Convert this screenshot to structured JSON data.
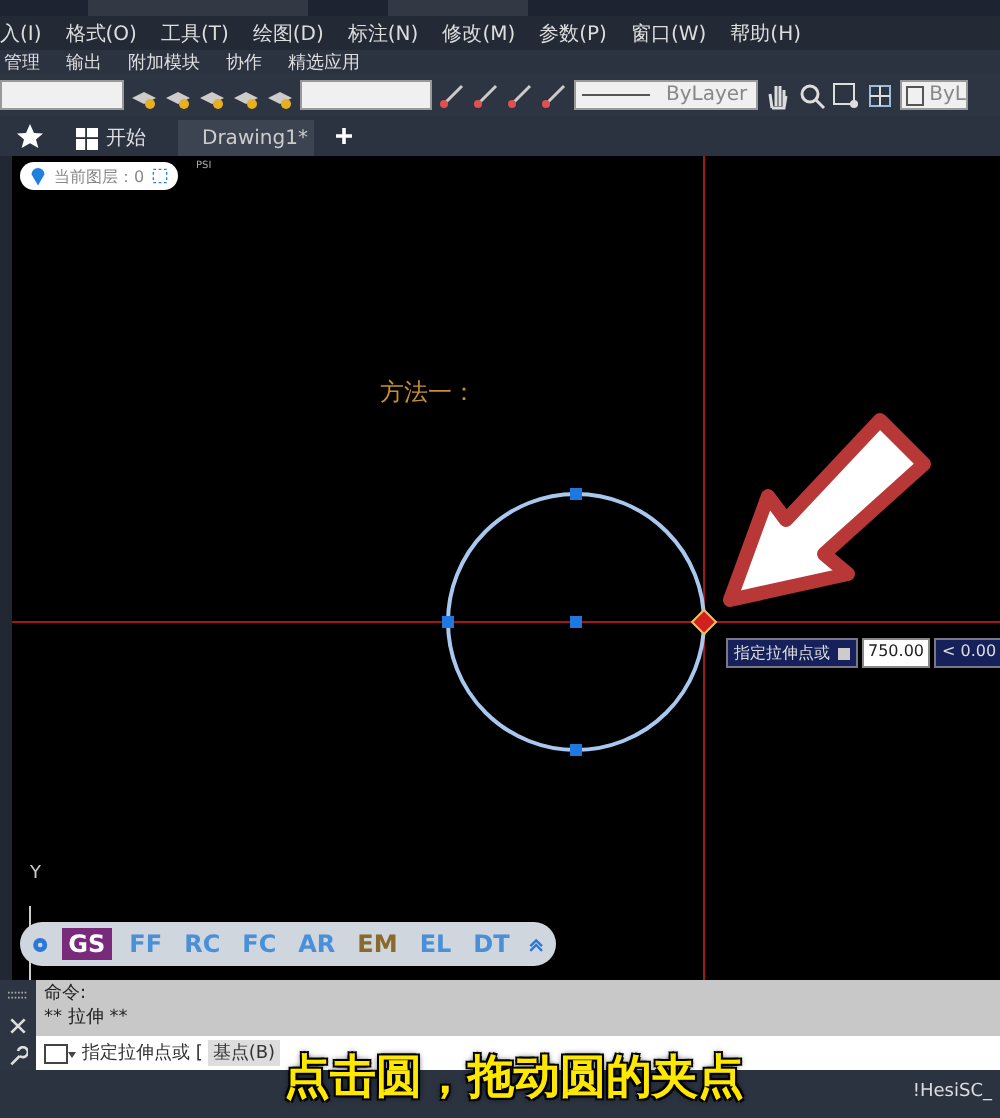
{
  "menu_bar": [
    "入(I)",
    "格式(O)",
    "工具(T)",
    "绘图(D)",
    "标注(N)",
    "修改(M)",
    "参数(P)",
    "窗口(W)",
    "帮助(H)"
  ],
  "ribbon_tabs": [
    "管理",
    "输出",
    "附加模块",
    "协作",
    "精选应用"
  ],
  "toolbar": {
    "linetype": "ByLayer",
    "lineweight": "ByL"
  },
  "file_tabs": [
    {
      "label": "开始",
      "selected": false
    },
    {
      "label": "Drawing1*",
      "selected": true
    }
  ],
  "canvas": {
    "layer_chip": "当前图层：0",
    "viewport_label": "PSI",
    "annotation": "方法一：",
    "axis_label": "Y",
    "dynamic_input": {
      "prompt": "指定拉伸点或",
      "value": "750.00",
      "angle": "< 0.00"
    },
    "quick_bar": [
      {
        "label": "GS",
        "selected": true,
        "color": "#7a2a7a"
      },
      {
        "label": "FF",
        "selected": false,
        "color": "#4a90d9"
      },
      {
        "label": "RC",
        "selected": false,
        "color": "#4a90d9"
      },
      {
        "label": "FC",
        "selected": false,
        "color": "#4a90d9"
      },
      {
        "label": "AR",
        "selected": false,
        "color": "#4a90d9"
      },
      {
        "label": "EM",
        "selected": false,
        "color": "#8a6a2a"
      },
      {
        "label": "EL",
        "selected": false,
        "color": "#4a90d9"
      },
      {
        "label": "DT",
        "selected": false,
        "color": "#4a90d9"
      }
    ]
  },
  "command_line": {
    "history": [
      "命令:",
      "** 拉伸 **"
    ],
    "prompt": "指定拉伸点或 [",
    "option": "基点(B)"
  },
  "status_bar": {
    "right_text": "!HesiSC_"
  },
  "subtitle": "点击圆，拖动圆的夹点"
}
